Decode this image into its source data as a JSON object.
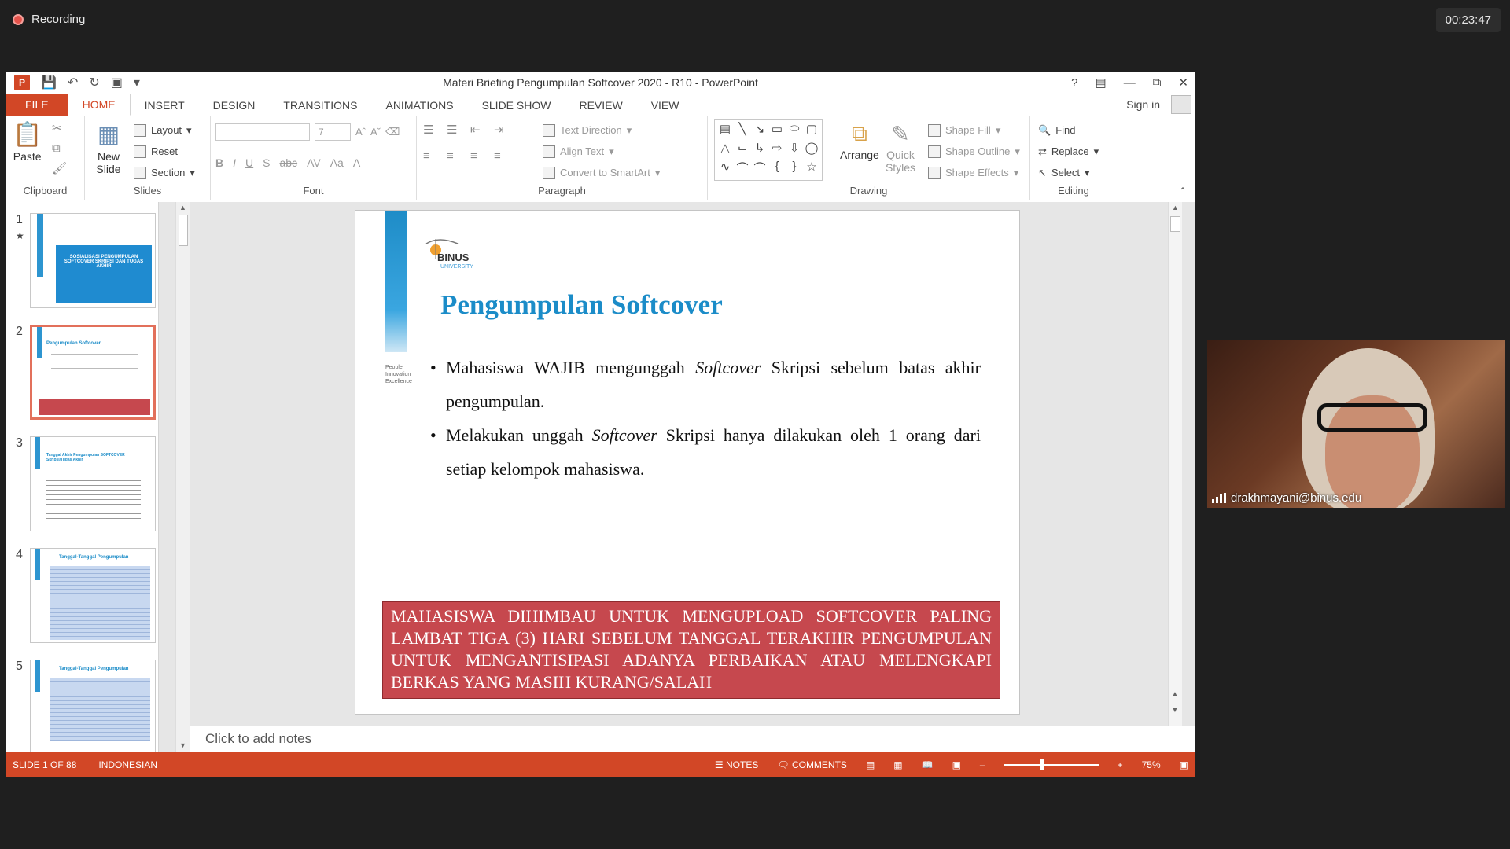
{
  "meeting": {
    "recording_label": "Recording",
    "timer": "00:23:47",
    "participant_name": "drakhmayani@binus.edu"
  },
  "window": {
    "title": "Materi Briefing Pengumpulan Softcover 2020 - R10 - PowerPoint",
    "help": "?",
    "signin": "Sign in"
  },
  "tabs": [
    "FILE",
    "HOME",
    "INSERT",
    "DESIGN",
    "TRANSITIONS",
    "ANIMATIONS",
    "SLIDE SHOW",
    "REVIEW",
    "VIEW"
  ],
  "ribbon": {
    "clipboard": {
      "paste": "Paste",
      "label": "Clipboard"
    },
    "slides": {
      "new_slide": "New Slide",
      "layout": "Layout",
      "reset": "Reset",
      "section": "Section",
      "label": "Slides"
    },
    "font": {
      "size": "7",
      "label": "Font"
    },
    "paragraph": {
      "text_direction": "Text Direction",
      "align_text": "Align Text",
      "convert": "Convert to SmartArt",
      "label": "Paragraph"
    },
    "drawing": {
      "arrange": "Arrange",
      "quick_styles": "Quick Styles",
      "shape_fill": "Shape Fill",
      "shape_outline": "Shape Outline",
      "shape_effects": "Shape Effects",
      "label": "Drawing"
    },
    "editing": {
      "find": "Find",
      "replace": "Replace",
      "select": "Select",
      "label": "Editing"
    }
  },
  "thumbnails": [
    {
      "num": "1",
      "text": "SOSIALISASI PENGUMPULAN SOFTCOVER SKRIPSI DAN TUGAS AKHIR"
    },
    {
      "num": "2",
      "text": "Pengumpulan Softcover"
    },
    {
      "num": "3",
      "text": "Tanggal Akhir Pengumpulan SOFTCOVER Skripsi/Tugas Akhir"
    },
    {
      "num": "4",
      "text": "Tanggal-Tanggal Pengumpulan"
    },
    {
      "num": "5",
      "text": "Tanggal-Tanggal Pengumpulan"
    }
  ],
  "slide": {
    "logo_text": "BINUS",
    "logo_sub": "UNIVERSITY",
    "tagline": "People Innovation Excellence",
    "title": "Pengumpulan Softcover",
    "bullet1_a": "Mahasiswa WAJIB  mengunggah ",
    "bullet1_em": "Softcover",
    "bullet1_b": " Skripsi sebelum batas akhir pengumpulan.",
    "bullet2_a": "Melakukan unggah ",
    "bullet2_em": "Softcover",
    "bullet2_b": " Skripsi hanya dilakukan oleh 1 orang dari setiap kelompok mahasiswa.",
    "warning": "MAHASISWA DIHIMBAU UNTUK MENGUPLOAD SOFTCOVER PALING LAMBAT TIGA (3) HARI SEBELUM TANGGAL TERAKHIR PENGUMPULAN UNTUK MENGANTISIPASI ADANYA PERBAIKAN ATAU MELENGKAPI BERKAS YANG MASIH KURANG/SALAH"
  },
  "notes_placeholder": "Click to add notes",
  "status": {
    "slide": "SLIDE 1 OF 88",
    "language": "INDONESIAN",
    "notes": "NOTES",
    "comments": "COMMENTS",
    "zoom": "75%"
  },
  "colors": {
    "accent": "#d24726",
    "title_blue": "#1b8cc8",
    "warning_red": "#c6484e"
  }
}
